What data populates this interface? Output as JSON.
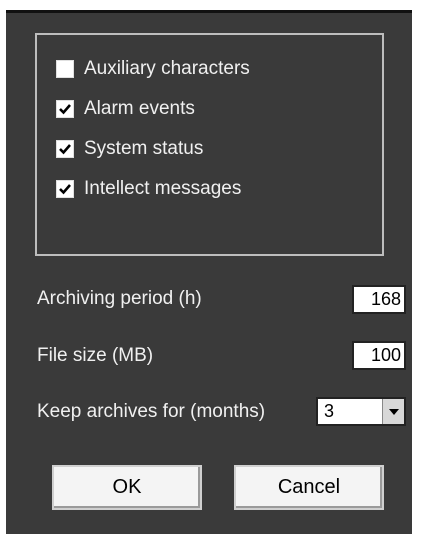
{
  "options_group": {
    "checkboxes": [
      {
        "label": "Auxiliary characters",
        "checked": false
      },
      {
        "label": "Alarm events",
        "checked": true
      },
      {
        "label": "System status",
        "checked": true
      },
      {
        "label": "Intellect messages",
        "checked": true
      }
    ]
  },
  "fields": {
    "archiving_period_label": "Archiving period (h)",
    "archiving_period_value": "168",
    "file_size_label": "File size (MB)",
    "file_size_value": "100",
    "keep_archives_label": "Keep archives for (months)",
    "keep_archives_value": "3"
  },
  "buttons": {
    "ok_label": "OK",
    "cancel_label": "Cancel"
  },
  "icons": {
    "checkmark": "check-icon",
    "dropdown": "chevron-down-icon"
  },
  "colors": {
    "dialog_background": "#3a3a3a",
    "text": "#f0f0f0"
  }
}
